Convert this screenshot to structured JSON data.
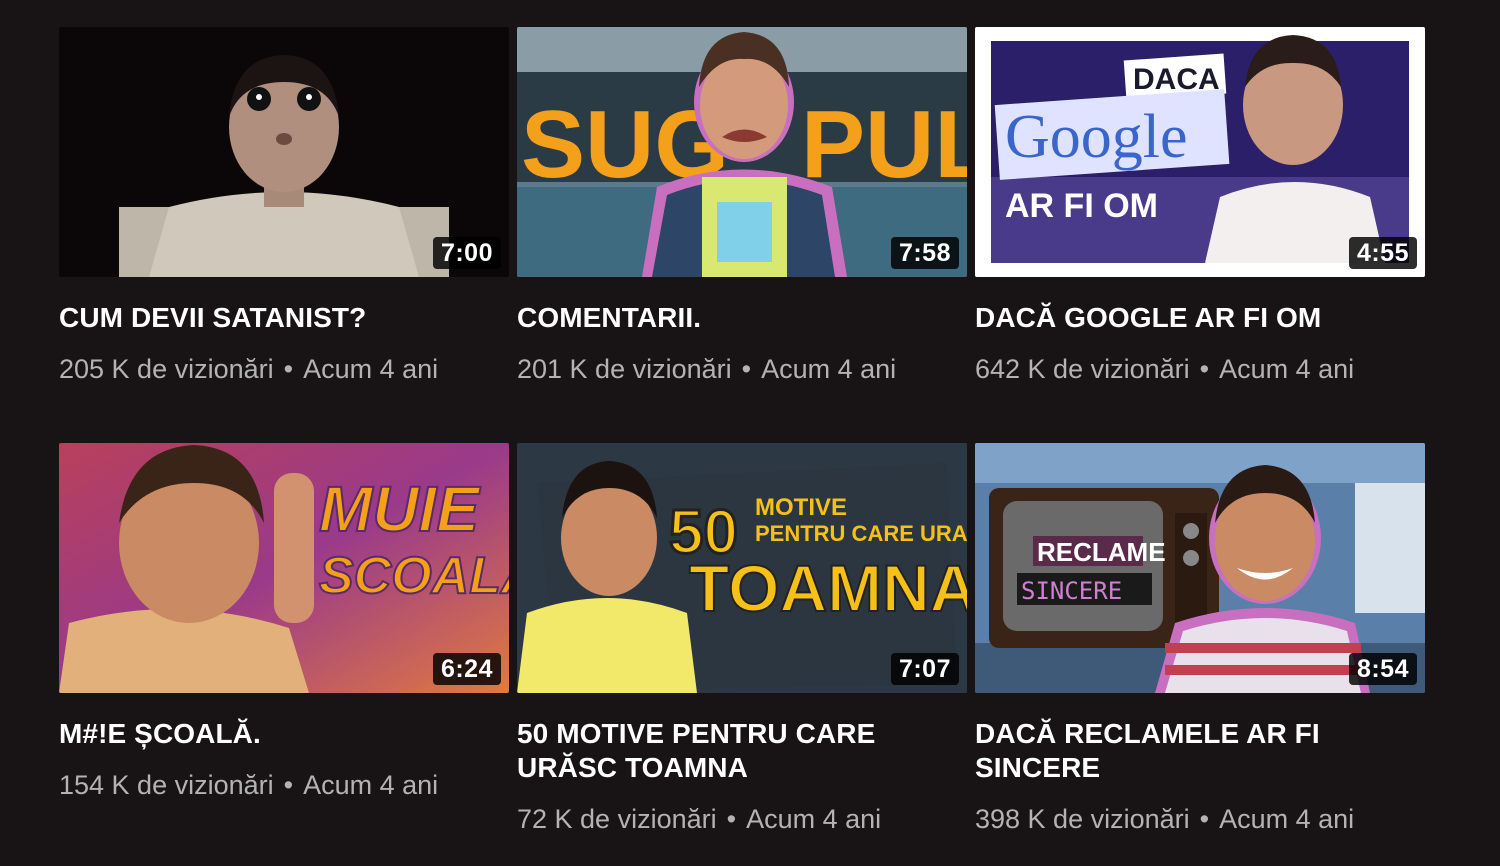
{
  "videos": [
    {
      "title": "CUM DEVII SATANIST?",
      "views": "205 K de vizionări",
      "age": "Acum 4 ani",
      "duration": "7:00",
      "thumb_text": []
    },
    {
      "title": "COMENTARII.",
      "views": "201 K de vizionări",
      "age": "Acum 4 ani",
      "duration": "7:58",
      "thumb_text": [
        "SUG",
        "PULA"
      ]
    },
    {
      "title": "DACĂ GOOGLE AR FI OM",
      "views": "642 K de vizionări",
      "age": "Acum 4 ani",
      "duration": "4:55",
      "thumb_text": [
        "DACA",
        "Google",
        "AR FI OM"
      ]
    },
    {
      "title": "M#!E ȘCOALĂ.",
      "views": "154 K de vizionări",
      "age": "Acum 4 ani",
      "duration": "6:24",
      "thumb_text": [
        "MUIE",
        "SCOALA"
      ]
    },
    {
      "title": "50 MOTIVE PENTRU CARE\nURĂSC TOAMNA",
      "views": "72 K de vizionări",
      "age": "Acum 4 ani",
      "duration": "7:07",
      "thumb_text": [
        "50",
        "MOTIVE",
        "PENTRU CARE URASC",
        "TOAMNA"
      ]
    },
    {
      "title": "DACĂ RECLAMELE AR FI\nSINCERE",
      "views": "398 K de vizionări",
      "age": "Acum 4 ani",
      "duration": "8:54",
      "thumb_text": [
        "RECLAME",
        "SINCERE"
      ]
    }
  ],
  "separator": "•",
  "colors": {
    "background": "#181415",
    "title": "#ffffff",
    "meta": "#b3b3b3",
    "accent_orange": "#f5a01a"
  }
}
